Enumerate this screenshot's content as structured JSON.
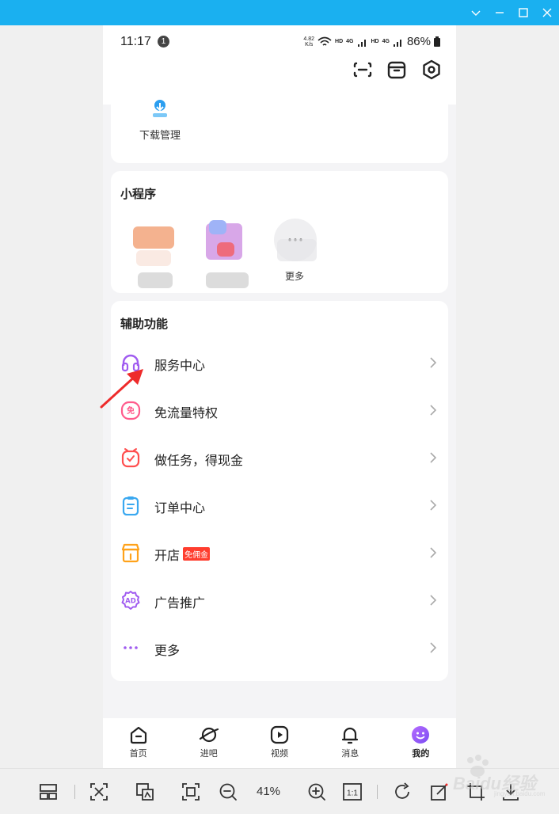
{
  "phone": {
    "status_bar": {
      "time": "11:17",
      "notification_count": "1",
      "net_speed_value": "4.82",
      "net_speed_unit": "K/s",
      "hd_label": "HD",
      "network_4g": "4G",
      "battery": "86%"
    },
    "download_card": {
      "label": "下载管理"
    },
    "mini_programs": {
      "title": "小程序",
      "more_label": "更多"
    },
    "assist": {
      "title": "辅助功能",
      "items": [
        {
          "label": "服务中心",
          "icon": "headphones-icon",
          "color": "#a05cf0"
        },
        {
          "label": "免流量特权",
          "icon": "free-data-icon",
          "color": "#ff5b8c"
        },
        {
          "label": "做任务，得现金",
          "icon": "alarm-check-icon",
          "color": "#ff4f4f"
        },
        {
          "label": "订单中心",
          "icon": "clipboard-icon",
          "color": "#3aa8f0"
        },
        {
          "label": "开店",
          "badge": "免佣金",
          "icon": "shop-icon",
          "color": "#ffa21a"
        },
        {
          "label": "广告推广",
          "icon": "ad-icon",
          "color": "#a05cf0"
        },
        {
          "label": "更多",
          "icon": "more-dots-icon",
          "color": "#a05cf0"
        }
      ]
    },
    "tabs": [
      {
        "label": "首页",
        "icon": "home-icon"
      },
      {
        "label": "进吧",
        "icon": "planet-icon"
      },
      {
        "label": "视频",
        "icon": "play-icon"
      },
      {
        "label": "消息",
        "icon": "bell-icon"
      },
      {
        "label": "我的",
        "icon": "smile-icon",
        "active": true
      }
    ]
  },
  "viewer": {
    "zoom": "41%",
    "actual_size_label": "1:1",
    "watermark": "Baidu经验",
    "watermark_sub": "jingyan.baidu.com"
  },
  "colors": {
    "titlebar": "#1ab0f0",
    "accent_purple": "#a05cf0",
    "arrow_red": "#ee2b2b"
  }
}
